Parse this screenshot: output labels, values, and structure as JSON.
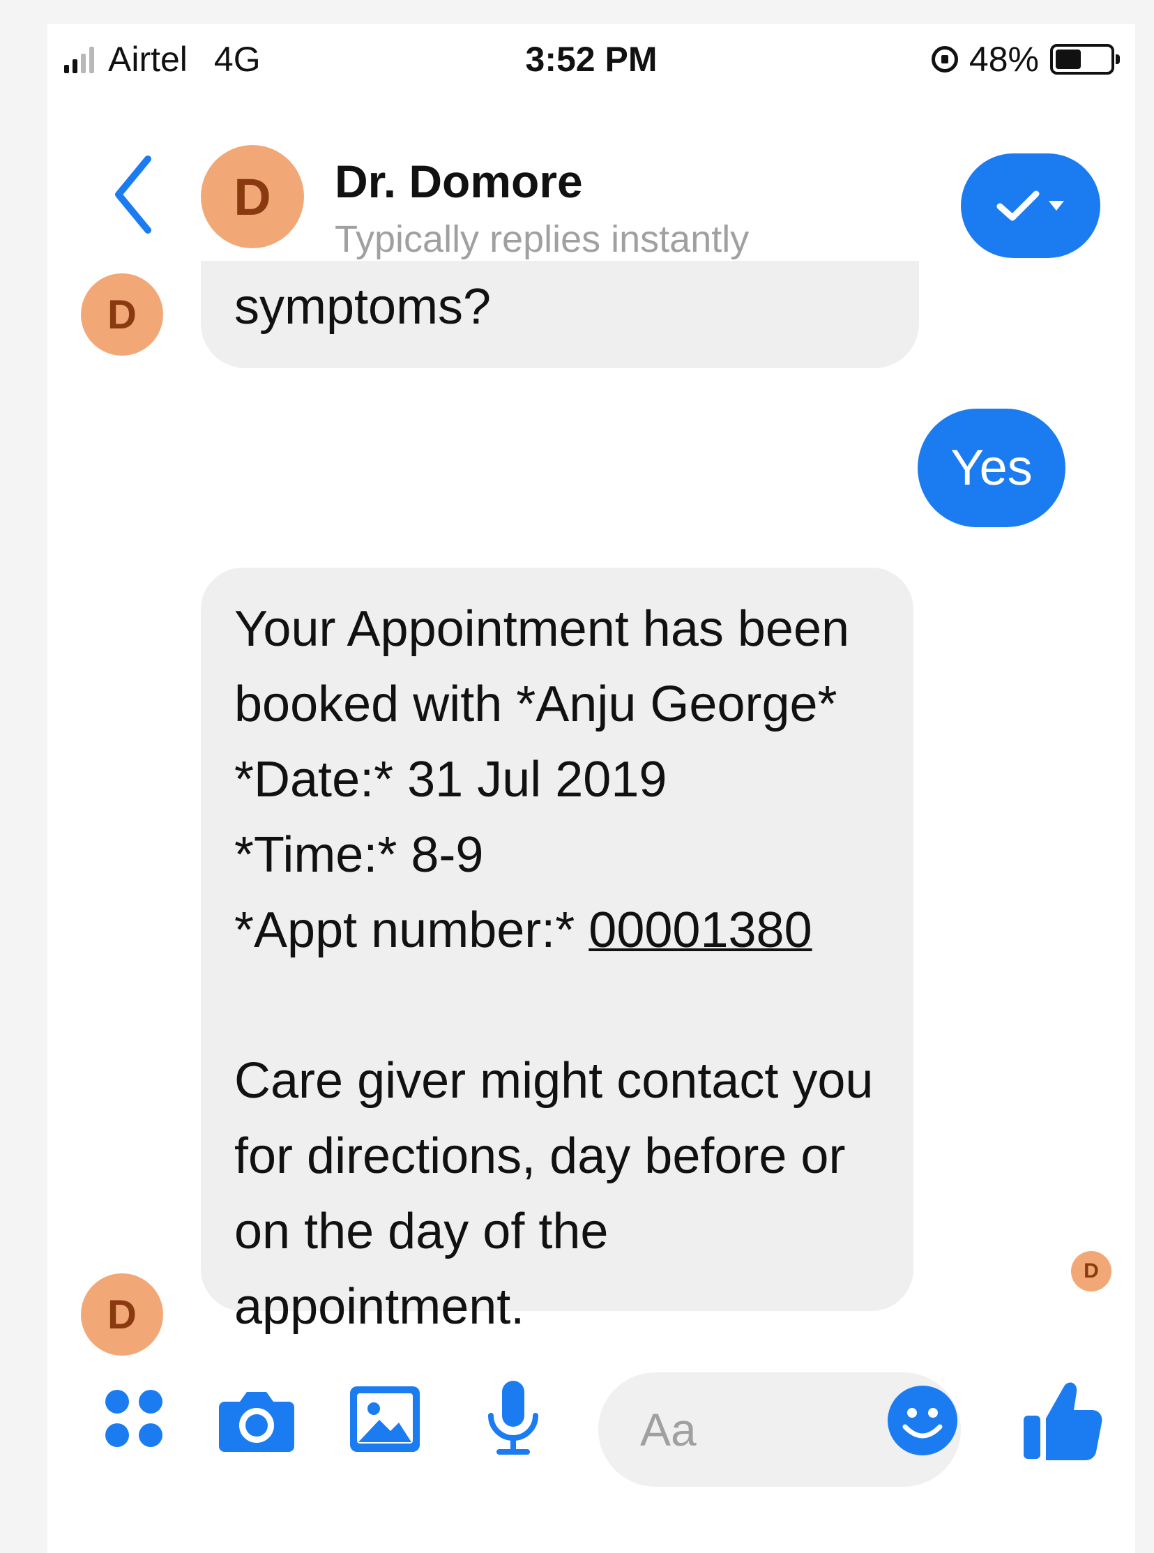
{
  "status_bar": {
    "carrier": "Airtel",
    "network": "4G",
    "time": "3:52 PM",
    "battery_percent": "48%",
    "battery_level": 0.48
  },
  "header": {
    "avatar_letter": "D",
    "contact_name": "Dr. Domore",
    "subtitle": "Typically replies instantly"
  },
  "messages": {
    "top_received": {
      "avatar_letter": "D",
      "text": "symptoms?"
    },
    "sent": {
      "text": "Yes"
    },
    "appointment": {
      "avatar_letter": "D",
      "lines": [
        "Your Appointment has been",
        "booked with *Anju George*",
        "*Date:* 31 Jul 2019",
        "*Time:* 8-9"
      ],
      "appt_label": "*Appt number:* ",
      "appt_number": "00001380",
      "note_lines": [
        "Care giver might contact you",
        "for directions, day before or",
        "on the day of the",
        "appointment."
      ]
    },
    "read_receipt_letter": "D"
  },
  "composer": {
    "placeholder": "Aa"
  },
  "colors": {
    "accent": "#1b7cf2",
    "avatar_bg": "#f2a876",
    "avatar_fg": "#8a3a10",
    "bubble_in": "#efefef"
  }
}
